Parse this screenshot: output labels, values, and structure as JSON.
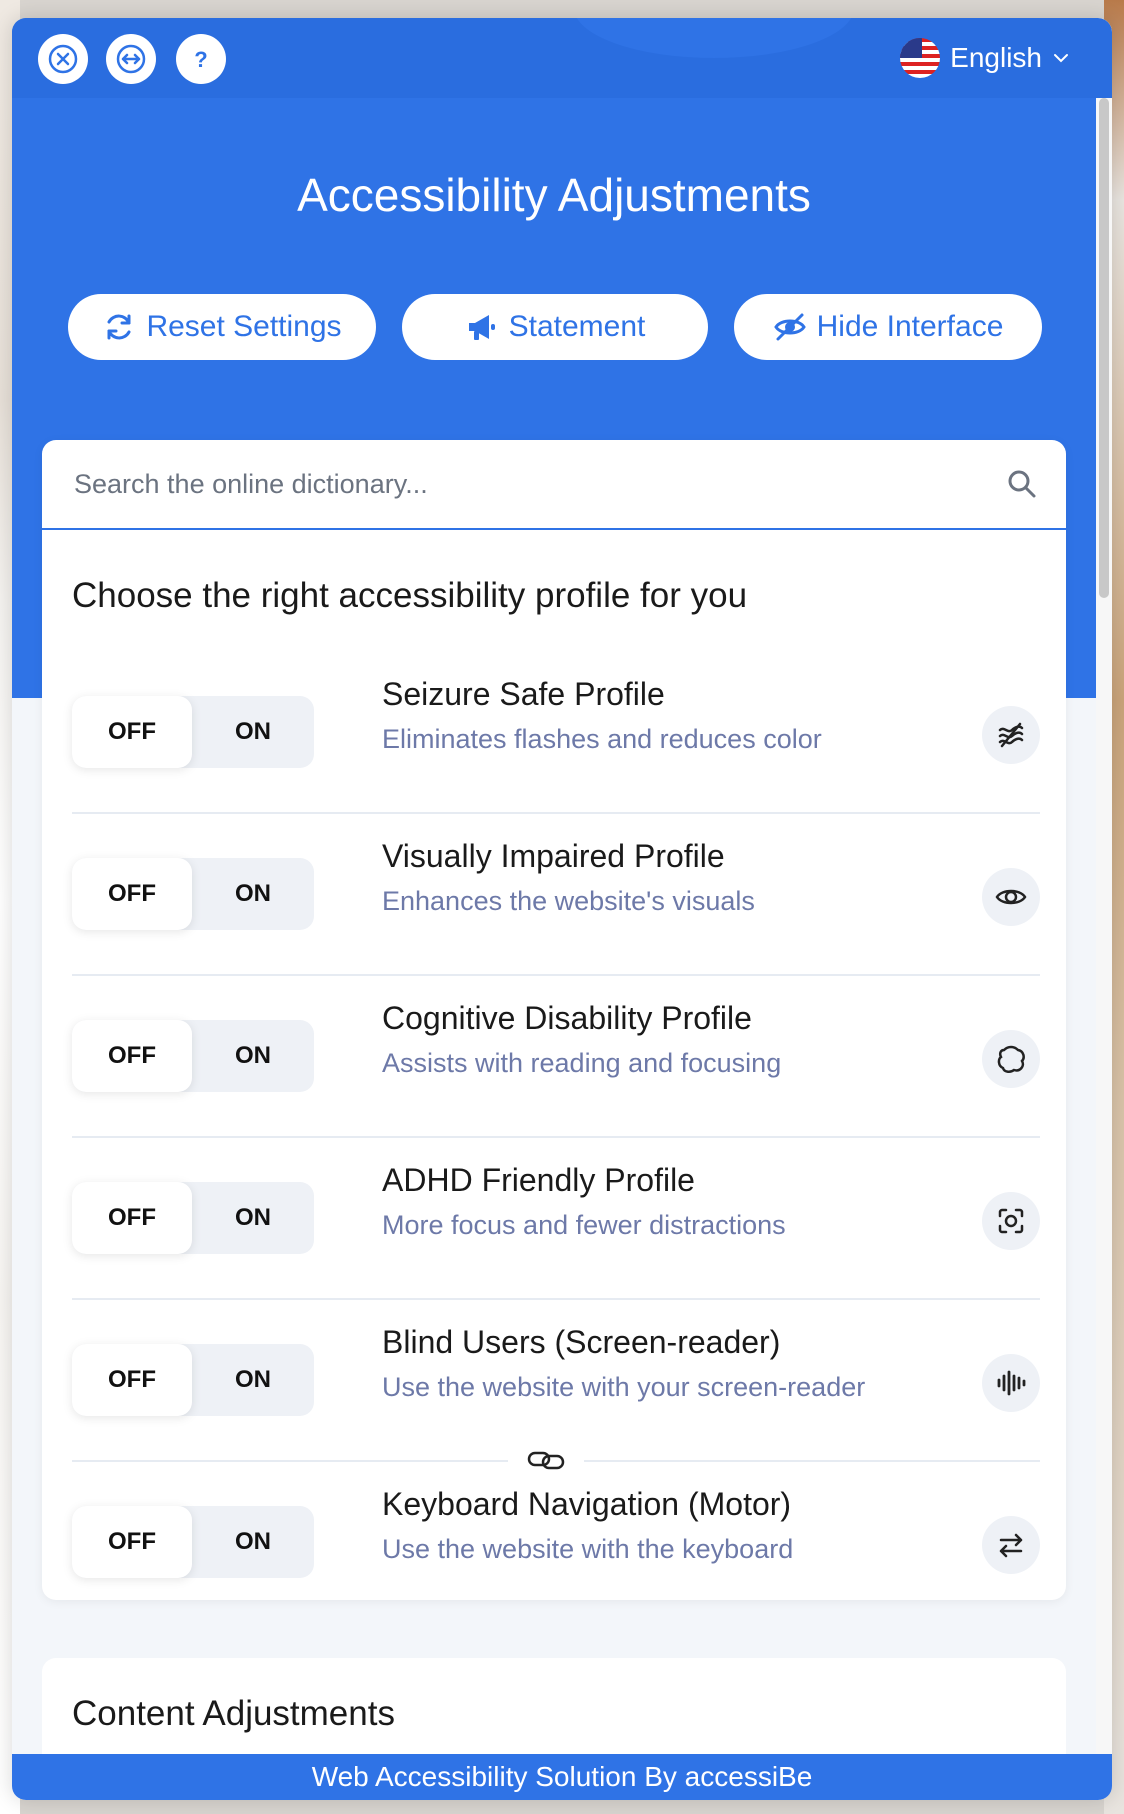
{
  "header": {
    "close_label": "Close",
    "language": "English"
  },
  "hero": {
    "title": "Accessibility Adjustments",
    "buttons": {
      "reset": "Reset Settings",
      "statement": "Statement",
      "hide": "Hide Interface"
    }
  },
  "search": {
    "placeholder": "Search the online dictionary..."
  },
  "profiles": {
    "section_title": "Choose the right accessibility profile for you",
    "off_label": "OFF",
    "on_label": "ON",
    "items": [
      {
        "name": "Seizure Safe Profile",
        "desc": "Eliminates flashes and reduces color",
        "icon": "seizure-icon"
      },
      {
        "name": "Visually Impaired Profile",
        "desc": "Enhances the website's visuals",
        "icon": "eye-icon"
      },
      {
        "name": "Cognitive Disability Profile",
        "desc": "Assists with reading and focusing",
        "icon": "brain-icon"
      },
      {
        "name": "ADHD Friendly Profile",
        "desc": "More focus and fewer distractions",
        "icon": "focus-icon"
      },
      {
        "name": "Blind Users (Screen-reader)",
        "desc": "Use the website with your screen-reader",
        "icon": "audio-wave-icon"
      },
      {
        "name": "Keyboard Navigation (Motor)",
        "desc": "Use the website with the keyboard",
        "icon": "arrows-swap-icon"
      }
    ]
  },
  "content_section": {
    "title": "Content Adjustments"
  },
  "footer": {
    "text": "Web Accessibility Solution By accessiBe"
  },
  "colors": {
    "primary": "#2f73e6",
    "muted_text": "#6d79a8",
    "toggle_bg": "#eef1f6"
  }
}
